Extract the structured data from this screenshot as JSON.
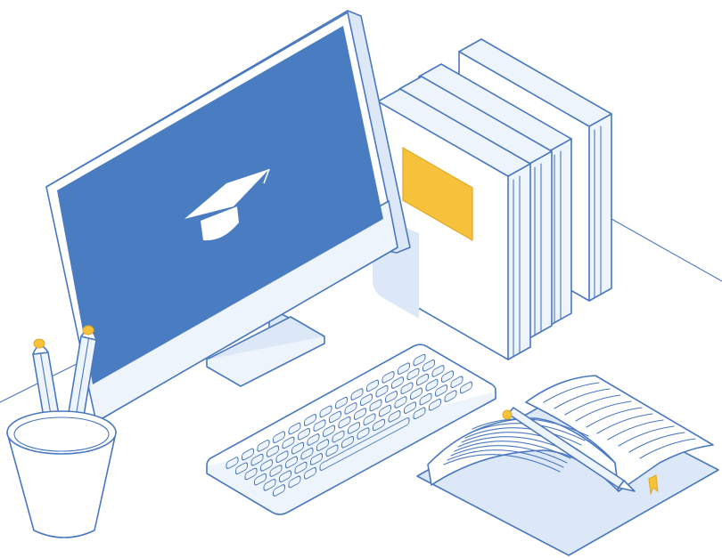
{
  "scene": {
    "colors": {
      "outline": "#4a78c0",
      "screen": "#4a7cc2",
      "pale_blue": "#dce8f7",
      "very_pale_blue": "#eef4fb",
      "accent_yellow": "#f7c23b",
      "white": "#ffffff"
    },
    "icons": [
      "graduation-cap-icon"
    ]
  }
}
